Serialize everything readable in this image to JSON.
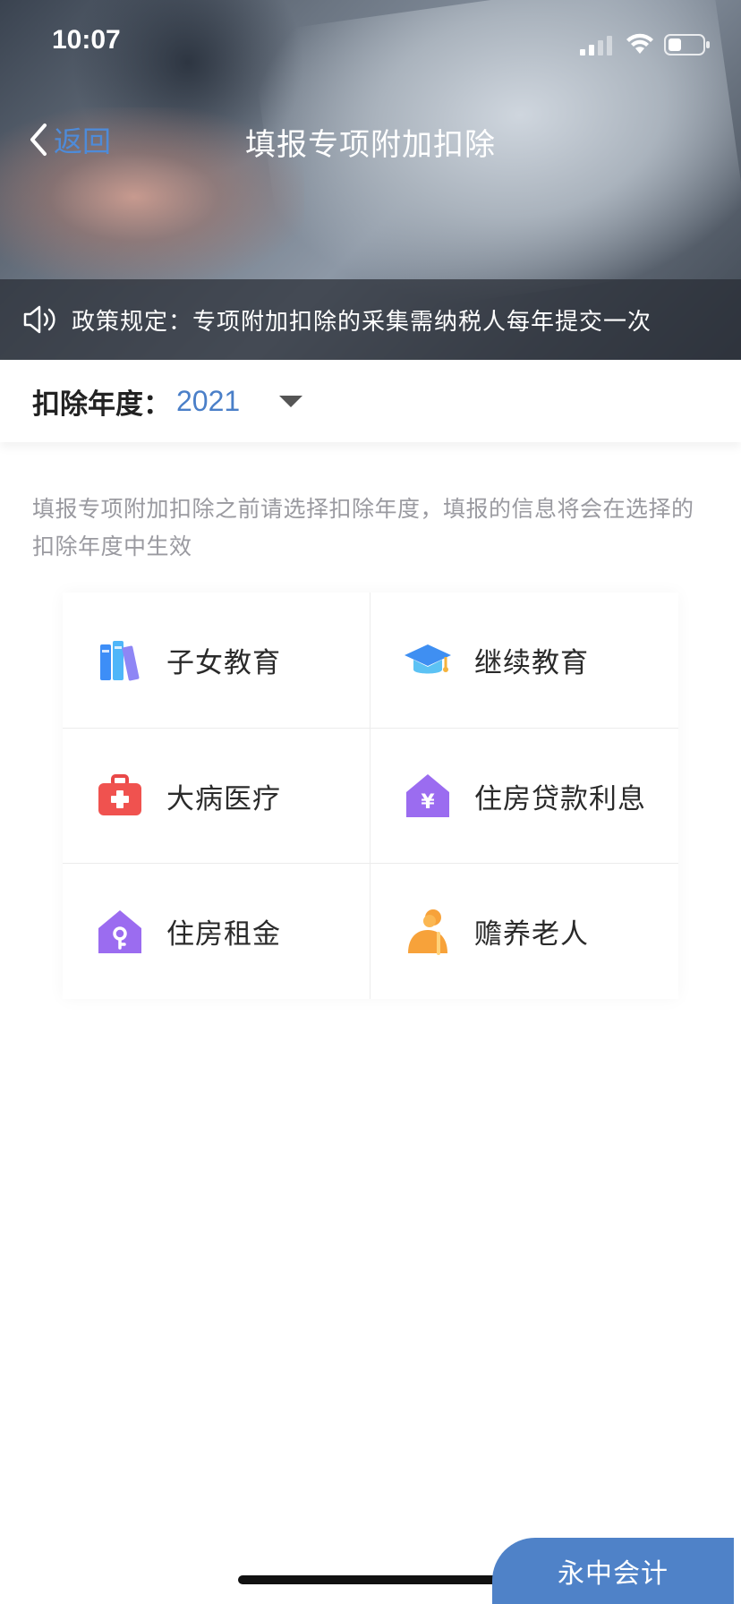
{
  "status_bar": {
    "time": "10:07"
  },
  "nav": {
    "back_label": "返回",
    "title": "填报专项附加扣除"
  },
  "notice": {
    "text": "政策规定：专项附加扣除的采集需纳税人每年提交一次"
  },
  "year_selector": {
    "label": "扣除年度：",
    "value": "2021"
  },
  "hint": "填报专项附加扣除之前请选择扣除年度，填报的信息将会在选择的扣除年度中生效",
  "items": [
    {
      "label": "子女教育",
      "icon": "books-icon"
    },
    {
      "label": "继续教育",
      "icon": "graduation-cap-icon"
    },
    {
      "label": "大病医疗",
      "icon": "medical-kit-icon"
    },
    {
      "label": "住房贷款利息",
      "icon": "house-yuan-icon"
    },
    {
      "label": "住房租金",
      "icon": "house-key-icon"
    },
    {
      "label": "赡养老人",
      "icon": "elderly-person-icon"
    }
  ],
  "watermark": "永中会计",
  "colors": {
    "accent": "#4a7fc8",
    "back_link": "#4e8bd9",
    "purple_icon": "#9b6cf0",
    "red_icon": "#f0524f",
    "orange_icon": "#f7a23a"
  }
}
